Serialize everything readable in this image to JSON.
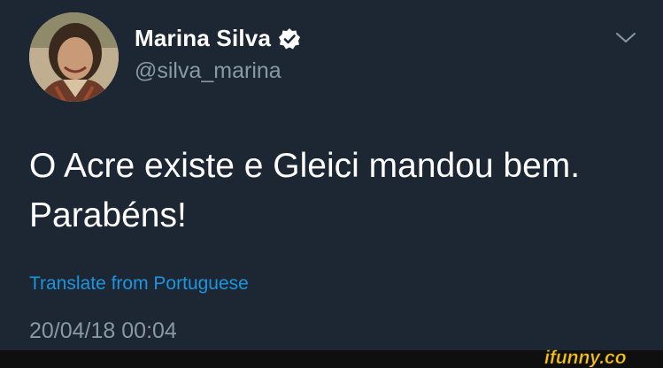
{
  "tweet": {
    "author_name": "Marina Silva",
    "author_handle": "@silva_marina",
    "text_line1": "O Acre existe e Gleici mandou bem.",
    "text_line2": "Parabéns!",
    "translate_label": "Translate from Portuguese",
    "timestamp": "20/04/18 00:04"
  },
  "icons": {
    "verified": "verified-badge-icon",
    "menu": "chevron-down-icon"
  },
  "watermark": {
    "text": "ifunny.co"
  },
  "colors": {
    "background": "#1c2733",
    "text": "#ffffff",
    "muted": "#8899a6",
    "link": "#1b95e0",
    "watermark": "#f5c518"
  }
}
